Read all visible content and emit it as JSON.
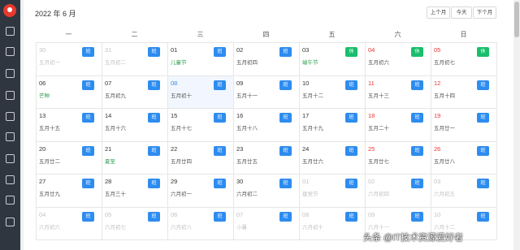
{
  "header": {
    "title": "2022 年 6 月"
  },
  "nav": {
    "prev": "上个月",
    "today": "今天",
    "next": "下个月"
  },
  "weekdays": [
    "一",
    "二",
    "三",
    "四",
    "五",
    "六",
    "日"
  ],
  "weeks": [
    [
      {
        "day": "30",
        "lunar": "五月初一",
        "badge": "班",
        "dim": true
      },
      {
        "day": "31",
        "lunar": "五月初二",
        "badge": "班",
        "dim": true
      },
      {
        "day": "01",
        "lunar": "儿童节",
        "badge": "班",
        "festival": true
      },
      {
        "day": "02",
        "lunar": "五月初四",
        "badge": "班"
      },
      {
        "day": "03",
        "lunar": "端午节",
        "badge": "休",
        "festival": true,
        "rest": true
      },
      {
        "day": "04",
        "lunar": "五月初六",
        "badge": "休",
        "red": true,
        "rest": true
      },
      {
        "day": "05",
        "lunar": "五月初七",
        "badge": "休",
        "red": true,
        "rest": true
      }
    ],
    [
      {
        "day": "06",
        "lunar": "芒种",
        "badge": "班",
        "festival": true
      },
      {
        "day": "07",
        "lunar": "五月初九",
        "badge": "班"
      },
      {
        "day": "08",
        "lunar": "五月初十",
        "badge": "班",
        "today": true
      },
      {
        "day": "09",
        "lunar": "五月十一",
        "badge": "班"
      },
      {
        "day": "10",
        "lunar": "五月十二",
        "badge": "班"
      },
      {
        "day": "11",
        "lunar": "五月十三",
        "badge": "班",
        "red": true
      },
      {
        "day": "12",
        "lunar": "五月十四",
        "badge": "班",
        "red": true
      }
    ],
    [
      {
        "day": "13",
        "lunar": "五月十五",
        "badge": "班"
      },
      {
        "day": "14",
        "lunar": "五月十六",
        "badge": "班"
      },
      {
        "day": "15",
        "lunar": "五月十七",
        "badge": "班"
      },
      {
        "day": "16",
        "lunar": "五月十八",
        "badge": "班"
      },
      {
        "day": "17",
        "lunar": "五月十九",
        "badge": "班"
      },
      {
        "day": "18",
        "lunar": "五月二十",
        "badge": "班",
        "red": true
      },
      {
        "day": "19",
        "lunar": "五月廿一",
        "badge": "班",
        "red": true
      }
    ],
    [
      {
        "day": "20",
        "lunar": "五月廿二",
        "badge": "班"
      },
      {
        "day": "21",
        "lunar": "夏至",
        "badge": "班",
        "festival": true
      },
      {
        "day": "22",
        "lunar": "五月廿四",
        "badge": "班"
      },
      {
        "day": "23",
        "lunar": "五月廿五",
        "badge": "班"
      },
      {
        "day": "24",
        "lunar": "五月廿六",
        "badge": "班"
      },
      {
        "day": "25",
        "lunar": "五月廿七",
        "badge": "班",
        "red": true
      },
      {
        "day": "26",
        "lunar": "五月廿八",
        "badge": "班",
        "red": true
      }
    ],
    [
      {
        "day": "27",
        "lunar": "五月廿九",
        "badge": "班"
      },
      {
        "day": "28",
        "lunar": "五月三十",
        "badge": "班"
      },
      {
        "day": "29",
        "lunar": "六月初一",
        "badge": "班"
      },
      {
        "day": "30",
        "lunar": "六月初二",
        "badge": "班"
      },
      {
        "day": "01",
        "lunar": "建党节",
        "badge": "班",
        "dim": true
      },
      {
        "day": "02",
        "lunar": "六月初四",
        "badge": "班",
        "dim": true
      },
      {
        "day": "03",
        "lunar": "六月初五",
        "badge": "班",
        "dim": true
      }
    ],
    [
      {
        "day": "04",
        "lunar": "六月初六",
        "badge": "班",
        "dim": true
      },
      {
        "day": "05",
        "lunar": "六月初七",
        "badge": "班",
        "dim": true
      },
      {
        "day": "06",
        "lunar": "六月初八",
        "badge": "班",
        "dim": true
      },
      {
        "day": "07",
        "lunar": "小暑",
        "badge": "班",
        "dim": true
      },
      {
        "day": "08",
        "lunar": "六月初十",
        "badge": "班",
        "dim": true
      },
      {
        "day": "09",
        "lunar": "六月十一",
        "badge": "班",
        "dim": true
      },
      {
        "day": "10",
        "lunar": "六月十二",
        "badge": "班",
        "dim": true
      }
    ]
  ],
  "sidebar_icons": [
    "home-icon",
    "settings-icon",
    "monitor-icon",
    "document-icon",
    "clipboard-icon",
    "calendar-icon",
    "layers-icon",
    "briefcase-icon",
    "user-icon",
    "chevron-icon"
  ],
  "watermark": "头条 @IT技术资源爱好者",
  "colors": {
    "work_badge": "#2d8cf0",
    "rest_badge": "#19be6b",
    "weekend": "#e53935",
    "festival": "#2e9e4f",
    "sidebar": "#2f3640"
  }
}
